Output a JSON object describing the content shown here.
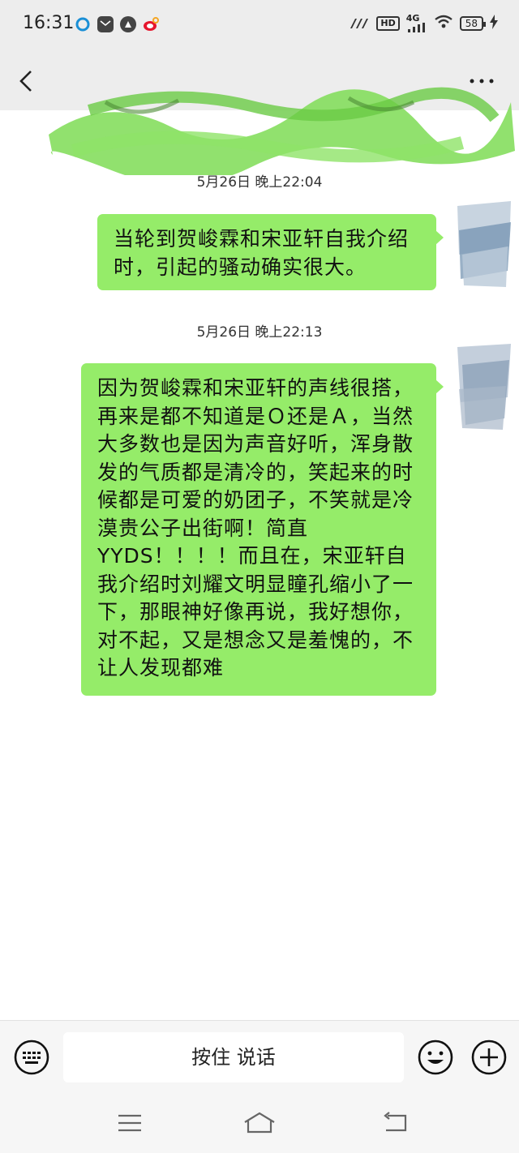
{
  "status_bar": {
    "time": "16:31",
    "network_label": "4G",
    "hd_label": "HD",
    "battery_level": "58",
    "icons": [
      "browser-icon",
      "mail-icon",
      "compass-icon",
      "weibo-icon",
      "signal-icon",
      "wifi-icon",
      "battery-icon",
      "charging-icon"
    ]
  },
  "header": {
    "title": "",
    "icons": [
      "back-chevron-icon",
      "more-dots-icon"
    ]
  },
  "messages": [
    {
      "timestamp": "5月26日 晚上22:04",
      "text": "当轮到贺峻霖和宋亚轩自我介绍时，引起的骚动确实很大。",
      "sender": "self"
    },
    {
      "timestamp": "5月26日 晚上22:13",
      "text": "因为贺峻霖和宋亚轩的声线很搭，再来是都不知道是Ｏ还是Ａ，当然大多数也是因为声音好听，浑身散发的气质都是清冷的，笑起来的时候都是可爱的奶团子，不笑就是冷漠贵公子出街啊！简直YYDS！！！！而且在，宋亚轩自我介绍时刘耀文明显瞳孔缩小了一下，那眼神好像再说，我好想你，对不起，又是想念又是羞愧的，不让人发现都难",
      "sender": "self"
    }
  ],
  "input_bar": {
    "voice_button_label": "按住 说话",
    "icons": [
      "keyboard-icon",
      "emoji-icon",
      "plus-icon"
    ]
  },
  "system_nav": {
    "icons": [
      "menu-icon",
      "home-icon",
      "back-icon"
    ]
  },
  "colors": {
    "bubble": "#95ec69",
    "header_bg": "#ededed",
    "chat_bg": "#ffffff"
  }
}
